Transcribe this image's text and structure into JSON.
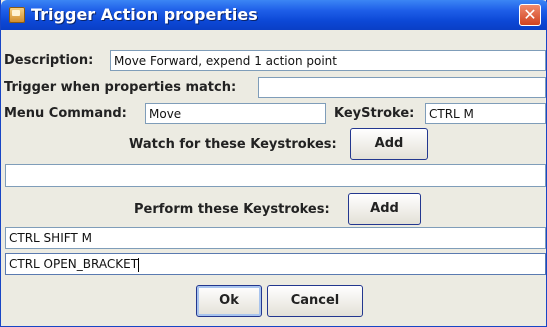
{
  "window": {
    "title": "Trigger Action properties"
  },
  "description": {
    "label": "Description:",
    "value": "Move Forward, expend 1 action point"
  },
  "trigger": {
    "label": "Trigger when properties match:",
    "value": ""
  },
  "menu_command": {
    "label": "Menu Command:",
    "value": "Move"
  },
  "keystroke": {
    "label": "KeyStroke:",
    "value": "CTRL M"
  },
  "watch": {
    "label": "Watch for these Keystrokes:",
    "add_label": "Add",
    "items": [
      ""
    ]
  },
  "perform": {
    "label": "Perform these Keystrokes:",
    "add_label": "Add",
    "items": [
      "CTRL SHIFT M",
      "CTRL OPEN_BRACKET"
    ]
  },
  "buttons": {
    "ok": "Ok",
    "cancel": "Cancel"
  }
}
